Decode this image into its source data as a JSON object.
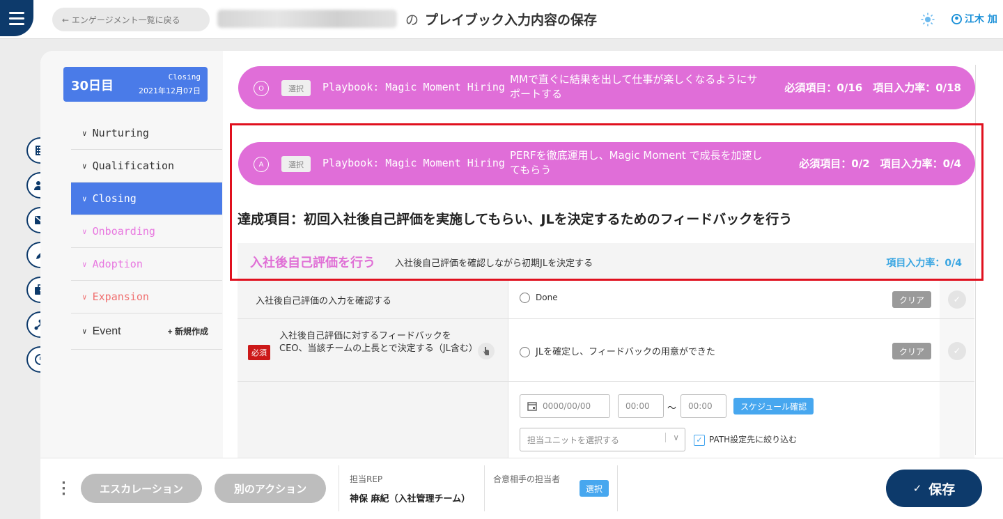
{
  "header": {
    "back_label": "← エンゲージメント一覧に戻る",
    "no": "の",
    "title": "プレイブック入力内容の保存",
    "user": "江木 加"
  },
  "day_box": {
    "day": "30日目",
    "stage": "Closing",
    "date": "2021年12月07日"
  },
  "nav": {
    "items": [
      {
        "label": "Nurturing"
      },
      {
        "label": "Qualification"
      },
      {
        "label": "Closing"
      },
      {
        "label": "Onboarding"
      },
      {
        "label": "Adoption"
      },
      {
        "label": "Expansion"
      },
      {
        "label": "Event"
      }
    ],
    "new_label": "+ 新規作成"
  },
  "playbooks": [
    {
      "marker": "O",
      "select": "選択",
      "name": "Playbook: Magic Moment Hiring",
      "desc": "MMで直ぐに結果を出して仕事が楽しくなるようにサポートする",
      "stats": "必須項目：0/16　項目入力率：0/18"
    },
    {
      "marker": "A",
      "select": "選択",
      "name": "Playbook: Magic Moment Hiring",
      "desc": "PERFを徹底運用し、Magic Moment で成長を加速してもらう",
      "stats": "必須項目：0/2　項目入力率：0/4"
    }
  ],
  "goal": "達成項目：初回入社後自己評価を実施してもらい、JLを決定するためのフィードバックを行う",
  "task": {
    "name": "入社後自己評価を行う",
    "desc": "入社後自己評価を確認しながら初期JLを決定する",
    "rate": "項目入力率：0/4"
  },
  "rows": [
    {
      "label": "入社後自己評価の入力を確認する",
      "option": "Done",
      "clear": "クリア"
    },
    {
      "required": "必須",
      "label": "入社後自己評価に対するフィードバックをCEO、当該チームの上長とで決定する（JL含む）",
      "option": "JLを確定し、フィードバックの用意ができた",
      "clear": "クリア"
    }
  ],
  "schedule": {
    "date_placeholder": "0000/00/00",
    "time_from": "00:00",
    "tilde": "〜",
    "time_to": "00:00",
    "confirm": "スケジュール確認",
    "unit_placeholder": "担当ユニットを選択する",
    "path_filter": "PATH設定先に絞り込む"
  },
  "footer": {
    "escalation": "エスカレーション",
    "other_action": "別のアクション",
    "rep_label": "担当REP",
    "rep_value": "神保 麻紀（入社管理チーム）",
    "counterpart_label": "合意相手の担当者",
    "counterpart_select": "選択",
    "save": "保存"
  }
}
